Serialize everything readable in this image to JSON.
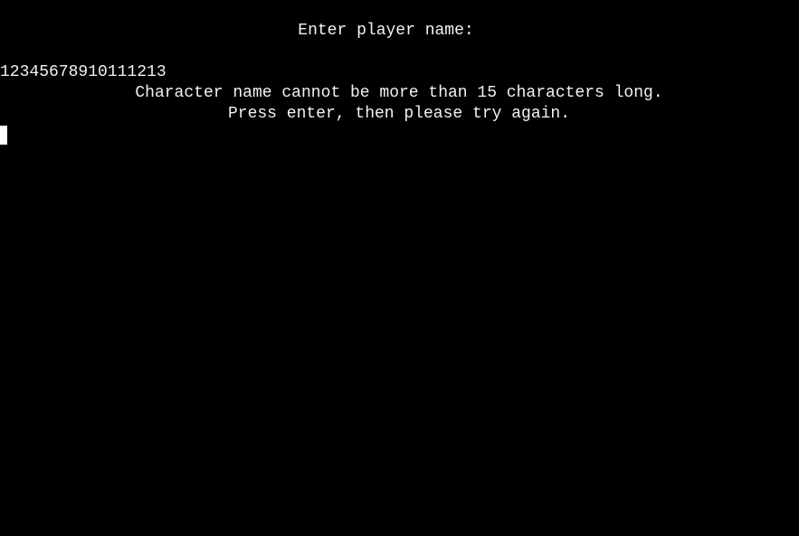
{
  "terminal": {
    "prompt": "Enter player name:",
    "typed_input": "12345678910111213",
    "error_line_1": "Character name cannot be more than 15 characters long.",
    "error_line_2": "Press enter, then please try again."
  },
  "colors": {
    "background": "#000000",
    "text": "#f2f2f2",
    "cursor": "#ffffff"
  }
}
